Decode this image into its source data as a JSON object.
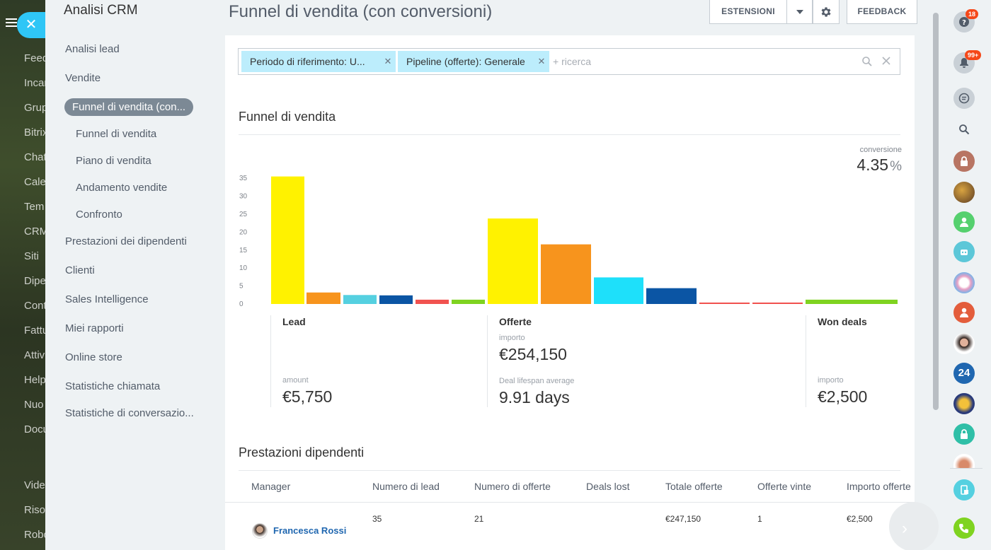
{
  "bg_nav": {
    "items": [
      "Feed",
      "Incar",
      "Grup",
      "Bitrix",
      "Chat",
      "Cale",
      "Tem",
      "CRM",
      "Siti",
      "Dipe",
      "Cont",
      "Fattu",
      "Attiv",
      "Help",
      "Nuo",
      "Docu",
      "Vide",
      "Riso",
      "Robo"
    ]
  },
  "menu": {
    "title": "Analisi CRM",
    "items": [
      {
        "label": "Analisi lead"
      },
      {
        "label": "Vendite"
      },
      {
        "label": "Funnel di vendita (con..."
      },
      {
        "label": "Funnel di vendita"
      },
      {
        "label": "Piano di vendita"
      },
      {
        "label": "Andamento vendite"
      },
      {
        "label": "Confronto"
      },
      {
        "label": "Prestazioni dei dipendenti"
      },
      {
        "label": "Clienti"
      },
      {
        "label": "Sales Intelligence"
      },
      {
        "label": "Miei rapporti"
      },
      {
        "label": "Online store"
      },
      {
        "label": "Statistiche chiamata"
      },
      {
        "label": "Statistiche di conversazio..."
      }
    ]
  },
  "header": {
    "title": "Funnel di vendita (con conversioni)",
    "extensions": "ESTENSIONI",
    "feedback": "FEEDBACK"
  },
  "filter": {
    "chips": [
      "Periodo di riferimento: U...",
      "Pipeline (offerte): Generale"
    ],
    "placeholder": "+ ricerca"
  },
  "funnel": {
    "title": "Funnel di vendita",
    "conversion_label": "conversione",
    "conversion_value": "4.35",
    "conversion_unit": "%",
    "stages": [
      {
        "name": "Lead",
        "metrics": [
          {
            "label": "amount",
            "value": "€5,750"
          }
        ]
      },
      {
        "name": "Offerte",
        "metrics": [
          {
            "label": "importo",
            "value": "€254,150"
          },
          {
            "label": "Deal lifespan average",
            "value": "9.91 days"
          }
        ]
      },
      {
        "name": "Won deals",
        "metrics": [
          {
            "label": "importo",
            "value": "€2,500"
          }
        ]
      }
    ]
  },
  "chart_data": {
    "type": "bar",
    "yticks": [
      "0",
      "5",
      "10",
      "15",
      "20",
      "25",
      "30",
      "35"
    ],
    "ylim": [
      0,
      37
    ],
    "bars": [
      {
        "group": "Lead",
        "value": 35.5,
        "color": "#fff200"
      },
      {
        "group": "Lead",
        "value": 3.2,
        "color": "#f7941d"
      },
      {
        "group": "Lead",
        "value": 2.5,
        "color": "#55d0e0"
      },
      {
        "group": "Lead",
        "value": 2.4,
        "color": "#0b55a4"
      },
      {
        "group": "Lead",
        "value": 1.2,
        "color": "#f1524f"
      },
      {
        "group": "Lead",
        "value": 1.2,
        "color": "#7fd320"
      },
      {
        "group": "Offerte",
        "value": 23.8,
        "color": "#fff200"
      },
      {
        "group": "Offerte",
        "value": 16.6,
        "color": "#f7941d"
      },
      {
        "group": "Offerte",
        "value": 7.4,
        "color": "#1ee0fa"
      },
      {
        "group": "Offerte",
        "value": 4.4,
        "color": "#0b55a4"
      },
      {
        "group": "Offerte",
        "value": 0.4,
        "color": "#f1524f"
      },
      {
        "group": "Offerte",
        "value": 0.4,
        "color": "#f1524f"
      },
      {
        "group": "Won deals",
        "value": 1.2,
        "color": "#7fd320"
      }
    ]
  },
  "performance": {
    "title": "Prestazioni dipendenti",
    "columns": [
      "Manager",
      "Numero di lead",
      "Numero di offerte",
      "Deals lost",
      "Totale offerte",
      "Offerte vinte",
      "Importo offerte"
    ],
    "rows": [
      {
        "manager": "Francesca Rossi",
        "lead": "35",
        "offerte": "21",
        "lost": "",
        "totale": "€247,150",
        "vinte": "1",
        "importo": "€2,500"
      }
    ]
  },
  "rightbar": {
    "help_badge": "18",
    "notifications_badge": "99+",
    "bitrix_label": "24"
  }
}
